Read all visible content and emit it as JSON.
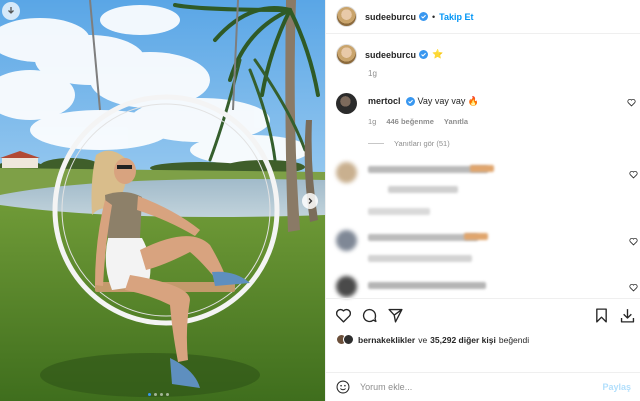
{
  "post": {
    "username": "sudeeburcu",
    "follow_label": "Takip Et",
    "separator": "•",
    "caption_emoji": "⭐",
    "caption_time": "1g",
    "carousel_slides": 4,
    "carousel_active": 1
  },
  "comments": [
    {
      "username": "mertocl",
      "text": "Vay vay vay 🔥",
      "time": "1g",
      "likes": "446 beğenme",
      "reply_label": "Yanıtla"
    }
  ],
  "replies_label": "Yanıtları gör (51)",
  "likes_summary": {
    "first_user": "bernakeklikler",
    "joiner": "ve",
    "others": "35,292 diğer kişi",
    "suffix": "beğendi"
  },
  "add_comment": {
    "placeholder": "Yorum ekle...",
    "post_label": "Paylaş"
  },
  "icons": {
    "download": "download-icon",
    "next": "chevron-right-icon",
    "verified": "verified-badge-icon",
    "like": "heart-icon",
    "comment": "comment-icon",
    "share": "send-icon",
    "save": "bookmark-icon",
    "emoji": "smiley-icon"
  },
  "colors": {
    "accent": "#0095f6",
    "verified": "#3897f0",
    "muted": "#8e8e8e",
    "border": "#efefef"
  }
}
